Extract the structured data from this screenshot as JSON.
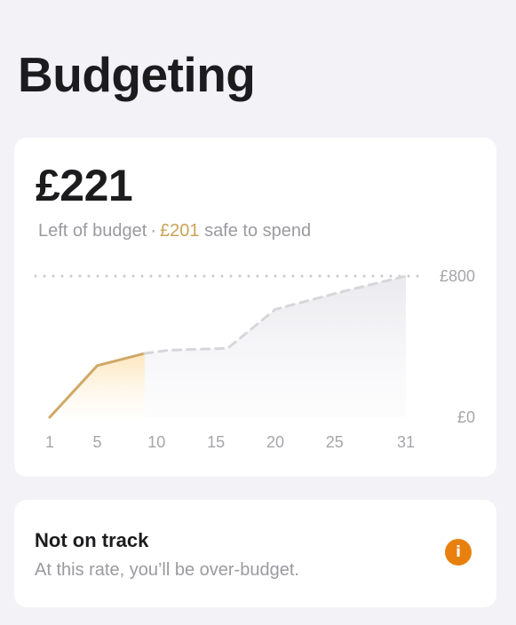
{
  "page": {
    "title": "Budgeting"
  },
  "budget": {
    "amount": "£221",
    "left_label": "Left of budget",
    "separator": "·",
    "safe_amount": "£201",
    "safe_label": "safe to spend"
  },
  "status": {
    "title": "Not on track",
    "text": "At this rate, you’ll be over-budget.",
    "icon": "info-icon"
  },
  "colors": {
    "accent_gold": "#c9a35a",
    "warning_orange": "#e8800e",
    "projection_gray": "#d6d6db"
  },
  "chart_data": {
    "type": "line",
    "xlabel": "",
    "ylabel": "",
    "x_ticks": [
      "1",
      "5",
      "10",
      "15",
      "20",
      "25",
      "31"
    ],
    "y_tick_labels": [
      "£800",
      "£0"
    ],
    "xlim": [
      1,
      31
    ],
    "ylim": [
      0,
      800
    ],
    "grid": "dotted line at top only",
    "series": [
      {
        "style": "solid-gold-area",
        "x": [
          1,
          5,
          9
        ],
        "y": [
          0,
          293,
          362
        ]
      },
      {
        "style": "dashed-gray-area",
        "x": [
          9,
          11,
          16,
          20,
          26,
          31
        ],
        "y": [
          362,
          380,
          391,
          612,
          718,
          800
        ]
      }
    ]
  }
}
